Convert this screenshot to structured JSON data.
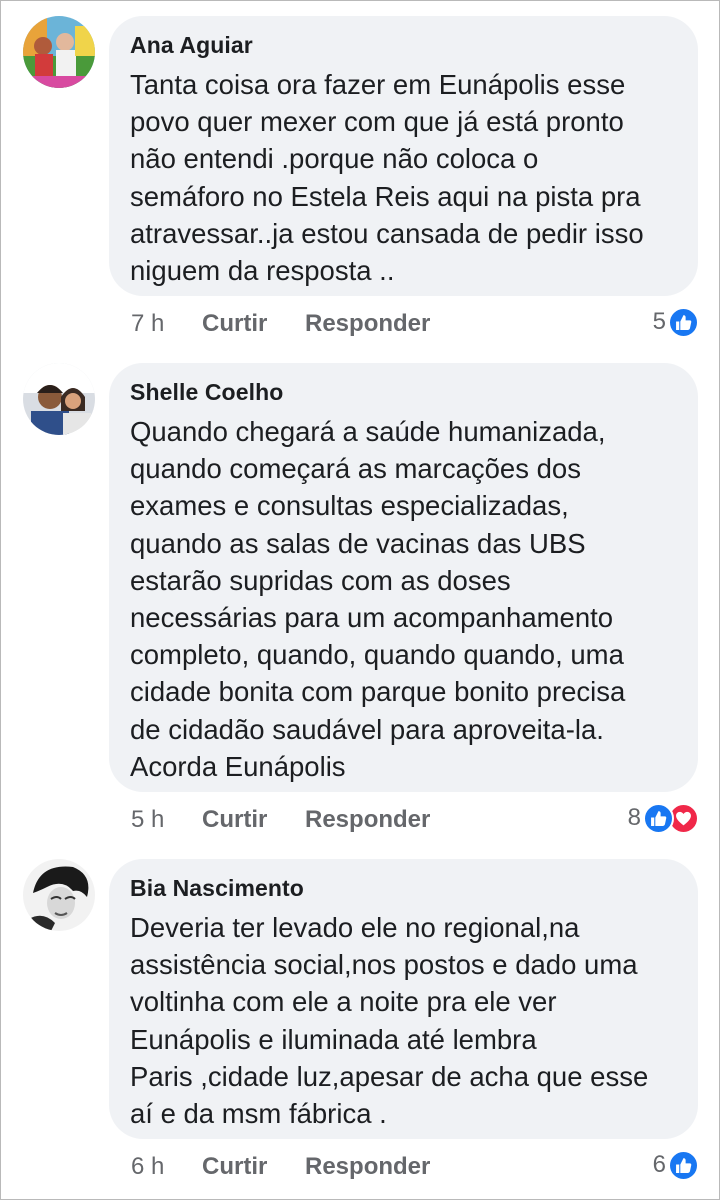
{
  "comments": [
    {
      "author": "Ana Aguiar",
      "text": "Tanta coisa ora fazer em Eunápolis esse\npovo quer mexer com que já está pronto\nnão entendi .porque não coloca o\nsemáforo no Estela Reis aqui na pista pra\natravessar..ja estou cansada de pedir isso\nniguem da resposta ..",
      "time": "7 h",
      "like_label": "Curtir",
      "reply_label": "Responder",
      "reaction_count": "5",
      "reactions": [
        "like-icon"
      ]
    },
    {
      "author": "Shelle Coelho",
      "text": "Quando chegará a saúde humanizada,\nquando começará as marcações dos\nexames e consultas especializadas,\nquando as salas de vacinas das UBS\nestarão supridas com as doses\nnecessárias para um acompanhamento\ncompleto, quando, quando quando, uma\ncidade bonita com parque bonito precisa\nde cidadão saudável para aproveita-la.\nAcorda Eunápolis",
      "time": "5 h",
      "like_label": "Curtir",
      "reply_label": "Responder",
      "reaction_count": "8",
      "reactions": [
        "like-icon",
        "love-icon"
      ]
    },
    {
      "author": "Bia Nascimento",
      "text": "Deveria ter levado ele no regional,na\nassistência social,nos postos e dado uma\nvoltinha com ele a noite pra ele ver\nEunápolis e iluminada até lembra\nParis ,cidade luz,apesar de acha que esse\naí e da msm fábrica .",
      "time": "6 h",
      "like_label": "Curtir",
      "reply_label": "Responder",
      "reaction_count": "6",
      "reactions": [
        "like-icon"
      ]
    }
  ],
  "colors": {
    "bubble_bg": "#f0f2f5",
    "text": "#1c1e21",
    "secondary_text": "#65676b",
    "like_blue": "#1877f2",
    "love_red": "#f02849"
  }
}
